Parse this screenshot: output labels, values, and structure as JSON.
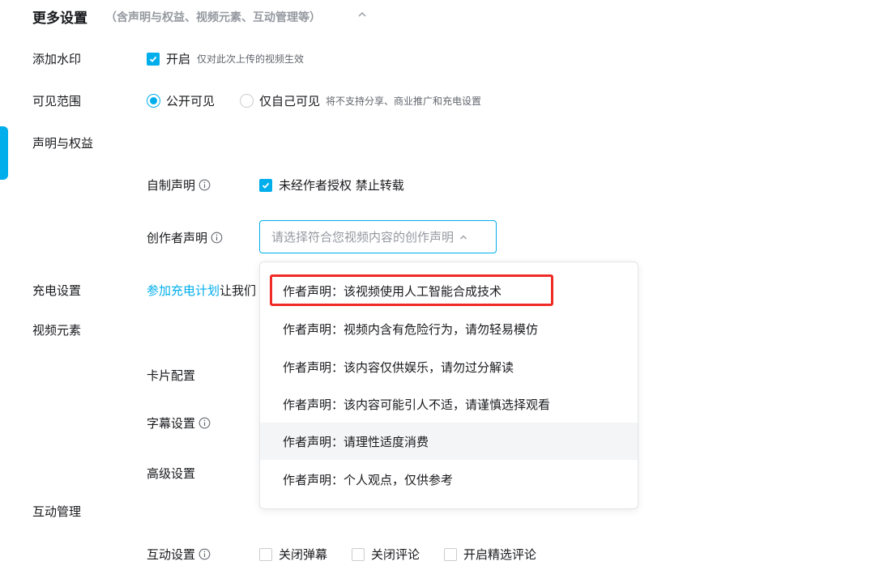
{
  "header": {
    "title": "更多设置",
    "subtitle": "（含声明与权益、视频元素、互动管理等）"
  },
  "watermark": {
    "label": "添加水印",
    "option_label": "开启",
    "hint": "仅对此次上传的视频生效",
    "checked": true
  },
  "visibility": {
    "label": "可见范围",
    "options": [
      {
        "label": "公开可见",
        "selected": true
      },
      {
        "label": "仅自己可见",
        "selected": false
      }
    ],
    "hint": "将不支持分享、商业推广和充电设置"
  },
  "declaration": {
    "label": "声明与权益",
    "self_made": {
      "label": "自制声明",
      "option_label": "未经作者授权 禁止转载",
      "checked": true
    },
    "creator": {
      "label": "创作者声明",
      "placeholder": "请选择符合您视频内容的创作声明"
    }
  },
  "charging": {
    "label": "充电设置",
    "link_text": "参加充电计划",
    "text": "让我们"
  },
  "video_elements": {
    "label": "视频元素",
    "card": "卡片配置",
    "subtitle": "字幕设置",
    "advanced": "高级设置"
  },
  "interaction": {
    "label": "互动管理",
    "settings_label": "互动设置",
    "options": [
      "关闭弹幕",
      "关闭评论",
      "开启精选评论"
    ]
  },
  "dropdown": {
    "items": [
      "作者声明：该视频使用人工智能合成技术",
      "作者声明：视频内含有危险行为，请勿轻易模仿",
      "作者声明：该内容仅供娱乐，请勿过分解读",
      "作者声明：该内容可能引人不适，请谨慎选择观看",
      "作者声明：请理性适度消费",
      "作者声明：个人观点，仅供参考"
    ],
    "hovered_index": 4,
    "highlighted_index": 0
  },
  "colors": {
    "accent": "#00aeec",
    "highlight": "#f02a25",
    "muted": "#9499a0"
  }
}
